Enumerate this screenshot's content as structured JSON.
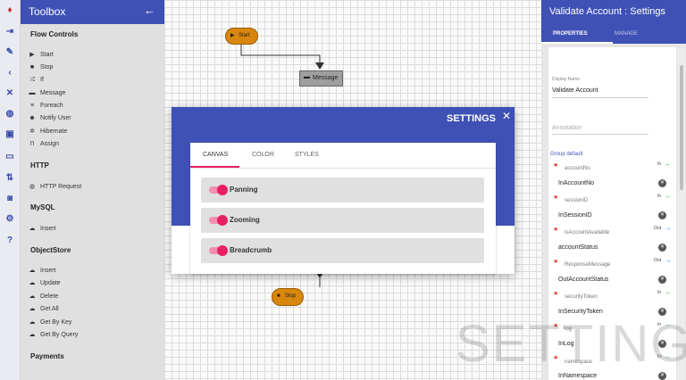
{
  "rail": {
    "icons": [
      "logo-icon",
      "import-icon",
      "edit-icon",
      "collapse-icon",
      "delete-icon",
      "globe-icon",
      "save-icon",
      "folder-icon",
      "sort-icon",
      "briefcase-icon",
      "gear-icon",
      "help-icon"
    ]
  },
  "toolbox": {
    "title": "Toolbox",
    "back_icon": "arrow-left-icon",
    "sections": [
      {
        "title": "Flow Controls",
        "items": [
          {
            "label": "Start",
            "icon": "play-icon"
          },
          {
            "label": "Stop",
            "icon": "stop-icon"
          },
          {
            "label": "If",
            "icon": "shuffle-icon"
          },
          {
            "label": "Message",
            "icon": "message-icon"
          },
          {
            "label": "Foreach",
            "icon": "list-icon"
          },
          {
            "label": "Notify User",
            "icon": "user-icon"
          },
          {
            "label": "Hibernate",
            "icon": "hibernate-icon"
          },
          {
            "label": "Assign",
            "icon": "assign-icon"
          }
        ]
      },
      {
        "title": "HTTP",
        "items": [
          {
            "label": "HTTP Request",
            "icon": "globe-icon"
          }
        ]
      },
      {
        "title": "MySQL",
        "items": [
          {
            "label": "Insert",
            "icon": "cloud-icon"
          }
        ]
      },
      {
        "title": "ObjectStore",
        "items": [
          {
            "label": "Insert",
            "icon": "cloud-icon"
          },
          {
            "label": "Update",
            "icon": "cloud-icon"
          },
          {
            "label": "Delete",
            "icon": "cloud-icon"
          },
          {
            "label": "Get All",
            "icon": "cloud-icon"
          },
          {
            "label": "Get By Key",
            "icon": "cloud-icon"
          },
          {
            "label": "Get By Query",
            "icon": "cloud-icon"
          }
        ]
      },
      {
        "title": "Payments",
        "items": []
      }
    ]
  },
  "canvas": {
    "nodes": {
      "start": "Start",
      "message": "Message",
      "stop": "Stop"
    }
  },
  "settings": {
    "title": "SETTINGS",
    "tabs": [
      "CANVAS",
      "COLOR",
      "STYLES"
    ],
    "active_tab": "CANVAS",
    "options": [
      {
        "label": "Panning",
        "enabled": true
      },
      {
        "label": "Zooming",
        "enabled": true
      },
      {
        "label": "Breadcrumb",
        "enabled": true
      }
    ],
    "accent": "#e91e63"
  },
  "props": {
    "title": "Validate Account : Settings",
    "tabs": [
      "PROPERTIES",
      "MANAGE"
    ],
    "display_name_label": "Display Name",
    "display_name": "Validate Account",
    "annotation_placeholder": "Annotation",
    "group_label": "Group default",
    "params": [
      {
        "name": "accountNo",
        "dir": "In",
        "value": "InAccountNo"
      },
      {
        "name": "sessionID",
        "dir": "In",
        "value": "InSessionID"
      },
      {
        "name": "isAccountAvailable",
        "dir": "Out",
        "value": "accountStatus"
      },
      {
        "name": "ResponseMessage",
        "dir": "Out",
        "value": "OutAccountStatus"
      },
      {
        "name": "securityToken",
        "dir": "In",
        "value": "InSecurityToken"
      },
      {
        "name": "log",
        "dir": "In",
        "value": "InLog"
      },
      {
        "name": "namespace",
        "dir": "In",
        "value": "InNamespace"
      }
    ]
  },
  "watermark": "SETTINGS",
  "colors": {
    "primary": "#3f51b5",
    "node": "#d9860f"
  }
}
